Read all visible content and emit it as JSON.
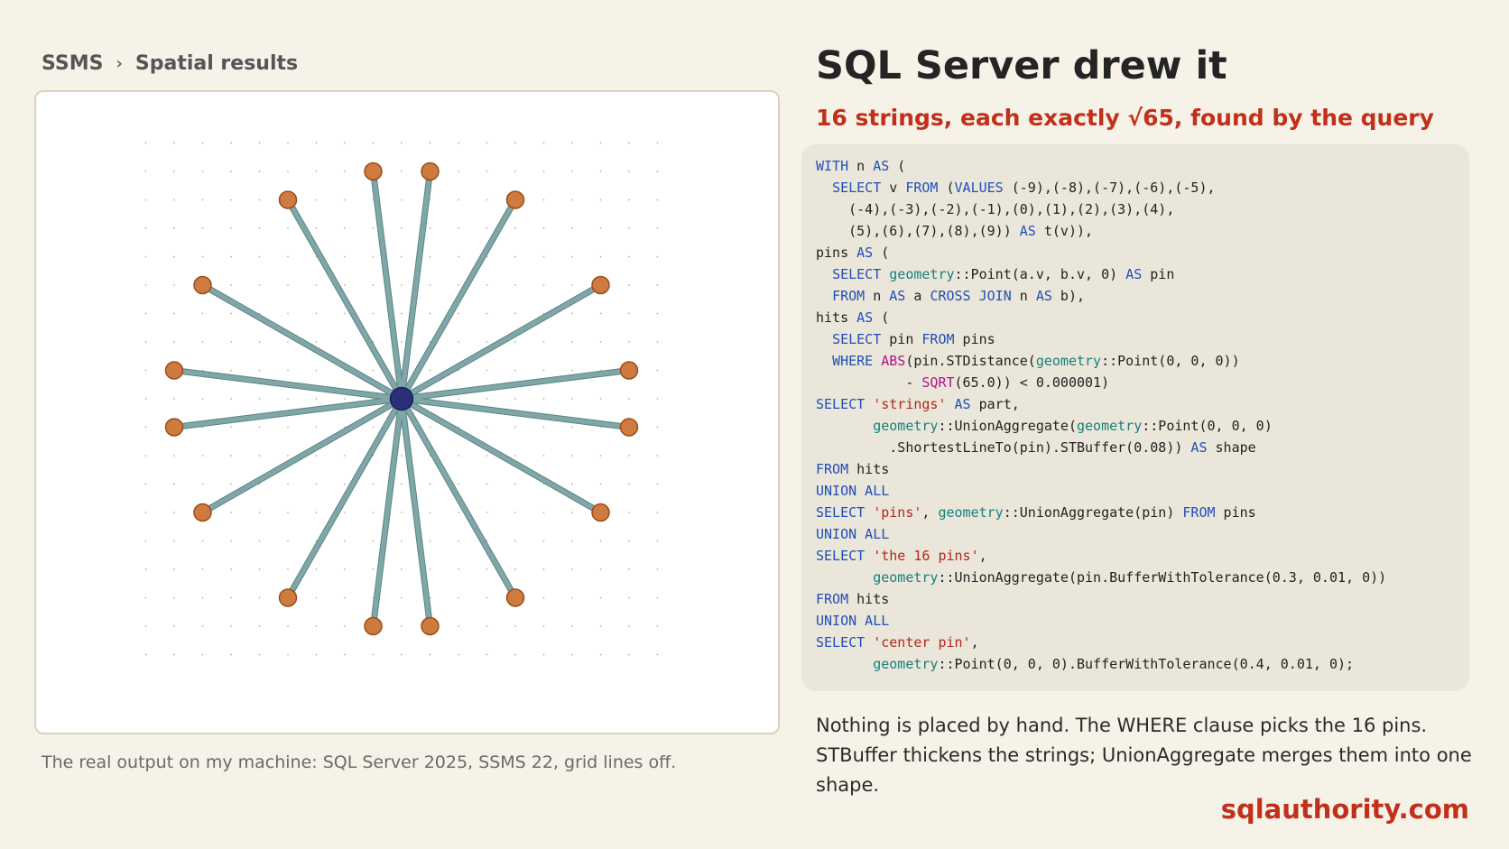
{
  "breadcrumb": {
    "app": "SSMS",
    "separator": "›",
    "page": "Spatial results"
  },
  "results_panel": {
    "caption": "The real output on my machine: SQL Server 2025, SSMS 22, grid lines off.",
    "grid_range": [
      -9,
      9
    ],
    "center_pin": [
      0,
      0
    ],
    "pins": [
      [
        8,
        1
      ],
      [
        7,
        4
      ],
      [
        4,
        7
      ],
      [
        1,
        8
      ],
      [
        -1,
        8
      ],
      [
        -4,
        7
      ],
      [
        -7,
        4
      ],
      [
        -8,
        1
      ],
      [
        -8,
        -1
      ],
      [
        -7,
        -4
      ],
      [
        -4,
        -7
      ],
      [
        -1,
        -8
      ],
      [
        1,
        -8
      ],
      [
        4,
        -7
      ],
      [
        7,
        -4
      ],
      [
        8,
        -1
      ]
    ],
    "colors": {
      "string": "#7fa7a8",
      "string_outline": "#5b8587",
      "pin": "#cf7a3e",
      "pin_outline": "#9a4d1c",
      "center": "#2b2f78",
      "grid_dot": "#b0b0b0"
    }
  },
  "heading": {
    "title": "SQL Server drew it",
    "subtitle": "16 strings, each exactly √65, found by the query"
  },
  "code_lines": [
    [
      [
        "kw",
        "WITH"
      ],
      [
        "t",
        " n "
      ],
      [
        "kw",
        "AS"
      ],
      [
        "t",
        " ("
      ]
    ],
    [
      [
        "t",
        "  "
      ],
      [
        "kw",
        "SELECT"
      ],
      [
        "t",
        " v "
      ],
      [
        "kw",
        "FROM"
      ],
      [
        "t",
        " ("
      ],
      [
        "kw",
        "VALUES"
      ],
      [
        "t",
        " (-9),(-8),(-7),(-6),(-5),"
      ]
    ],
    [
      [
        "t",
        "    (-4),(-3),(-2),(-1),(0),(1),(2),(3),(4),"
      ]
    ],
    [
      [
        "t",
        "    (5),(6),(7),(8),(9)) "
      ],
      [
        "kw",
        "AS"
      ],
      [
        "t",
        " t(v)),"
      ]
    ],
    [
      [
        "t",
        "pins "
      ],
      [
        "kw",
        "AS"
      ],
      [
        "t",
        " ("
      ]
    ],
    [
      [
        "t",
        "  "
      ],
      [
        "kw",
        "SELECT"
      ],
      [
        "t",
        " "
      ],
      [
        "ty",
        "geometry"
      ],
      [
        "t",
        "::Point(a.v, b.v, 0) "
      ],
      [
        "kw",
        "AS"
      ],
      [
        "t",
        " pin"
      ]
    ],
    [
      [
        "t",
        "  "
      ],
      [
        "kw",
        "FROM"
      ],
      [
        "t",
        " n "
      ],
      [
        "kw",
        "AS"
      ],
      [
        "t",
        " a "
      ],
      [
        "kw",
        "CROSS JOIN"
      ],
      [
        "t",
        " n "
      ],
      [
        "kw",
        "AS"
      ],
      [
        "t",
        " b),"
      ]
    ],
    [
      [
        "t",
        "hits "
      ],
      [
        "kw",
        "AS"
      ],
      [
        "t",
        " ("
      ]
    ],
    [
      [
        "t",
        "  "
      ],
      [
        "kw",
        "SELECT"
      ],
      [
        "t",
        " pin "
      ],
      [
        "kw",
        "FROM"
      ],
      [
        "t",
        " pins"
      ]
    ],
    [
      [
        "t",
        "  "
      ],
      [
        "kw",
        "WHERE"
      ],
      [
        "t",
        " "
      ],
      [
        "fn",
        "ABS"
      ],
      [
        "t",
        "(pin.STDistance("
      ],
      [
        "ty",
        "geometry"
      ],
      [
        "t",
        "::Point(0, 0, 0))"
      ]
    ],
    [
      [
        "t",
        "           - "
      ],
      [
        "fn",
        "SQRT"
      ],
      [
        "t",
        "(65.0)) < 0.000001)"
      ]
    ],
    [
      [
        "kw",
        "SELECT"
      ],
      [
        "t",
        " "
      ],
      [
        "str",
        "'strings'"
      ],
      [
        "t",
        " "
      ],
      [
        "kw",
        "AS"
      ],
      [
        "t",
        " part,"
      ]
    ],
    [
      [
        "t",
        "       "
      ],
      [
        "ty",
        "geometry"
      ],
      [
        "t",
        "::UnionAggregate("
      ],
      [
        "ty",
        "geometry"
      ],
      [
        "t",
        "::Point(0, 0, 0)"
      ]
    ],
    [
      [
        "t",
        "         .ShortestLineTo(pin).STBuffer(0.08)) "
      ],
      [
        "kw",
        "AS"
      ],
      [
        "t",
        " shape"
      ]
    ],
    [
      [
        "kw",
        "FROM"
      ],
      [
        "t",
        " hits"
      ]
    ],
    [
      [
        "kw",
        "UNION ALL"
      ]
    ],
    [
      [
        "kw",
        "SELECT"
      ],
      [
        "t",
        " "
      ],
      [
        "str",
        "'pins'"
      ],
      [
        "t",
        ", "
      ],
      [
        "ty",
        "geometry"
      ],
      [
        "t",
        "::UnionAggregate(pin) "
      ],
      [
        "kw",
        "FROM"
      ],
      [
        "t",
        " pins"
      ]
    ],
    [
      [
        "kw",
        "UNION ALL"
      ]
    ],
    [
      [
        "kw",
        "SELECT"
      ],
      [
        "t",
        " "
      ],
      [
        "str",
        "'the 16 pins'"
      ],
      [
        "t",
        ","
      ]
    ],
    [
      [
        "t",
        "       "
      ],
      [
        "ty",
        "geometry"
      ],
      [
        "t",
        "::UnionAggregate(pin.BufferWithTolerance(0.3, 0.01, 0))"
      ]
    ],
    [
      [
        "kw",
        "FROM"
      ],
      [
        "t",
        " hits"
      ]
    ],
    [
      [
        "kw",
        "UNION ALL"
      ]
    ],
    [
      [
        "kw",
        "SELECT"
      ],
      [
        "t",
        " "
      ],
      [
        "str",
        "'center pin'"
      ],
      [
        "t",
        ","
      ]
    ],
    [
      [
        "t",
        "       "
      ],
      [
        "ty",
        "geometry"
      ],
      [
        "t",
        "::Point(0, 0, 0).BufferWithTolerance(0.4, 0.01, 0);"
      ]
    ]
  ],
  "description": {
    "line1": "Nothing is placed by hand. The WHERE clause picks the 16 pins.",
    "line2": "STBuffer thickens the strings; UnionAggregate merges them into one shape."
  },
  "brand": "sqlauthority.com"
}
